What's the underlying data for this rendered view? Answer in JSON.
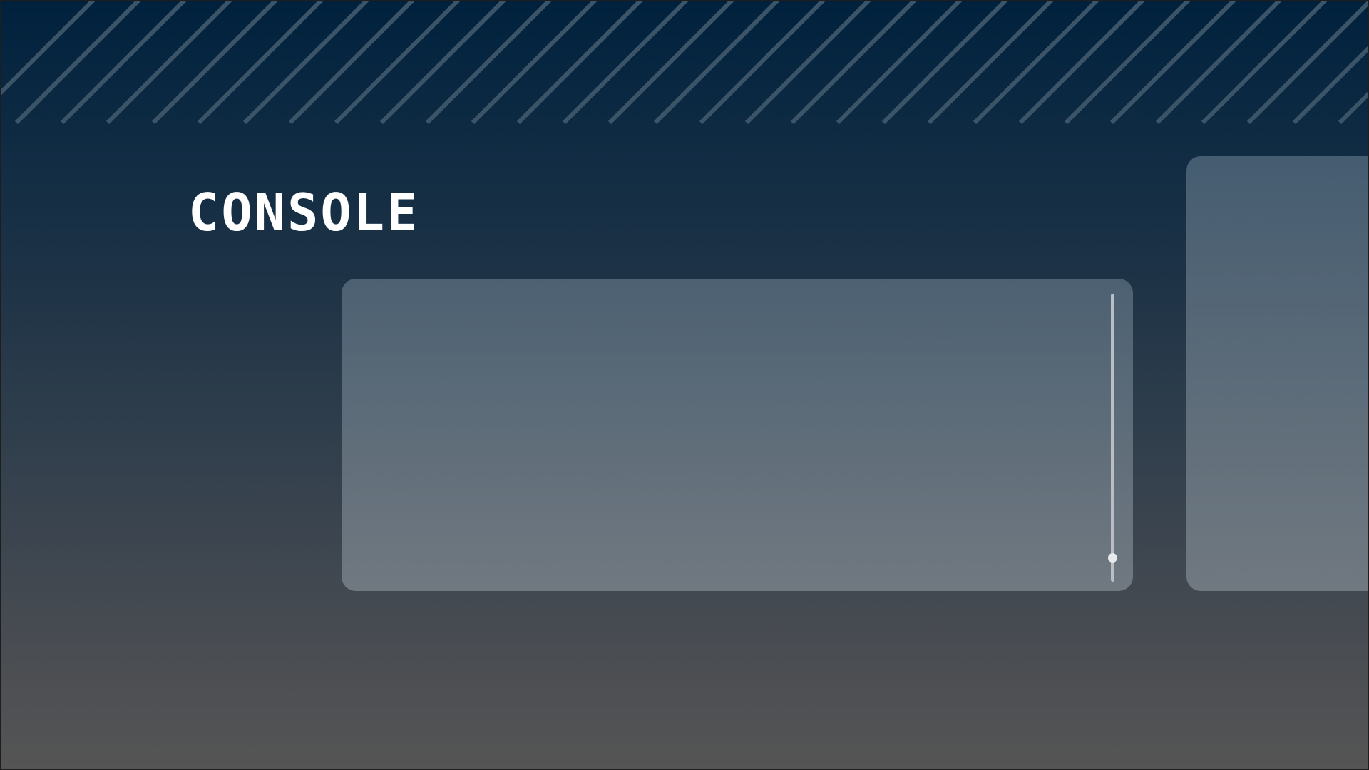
{
  "header": {
    "title": "CONSOLE"
  },
  "colors": {
    "background_top": "#00213d",
    "background_bottom": "#555555",
    "stripe": "#3b5468",
    "title": "#ffffff"
  },
  "console": {
    "scroll_position": 0.93
  }
}
